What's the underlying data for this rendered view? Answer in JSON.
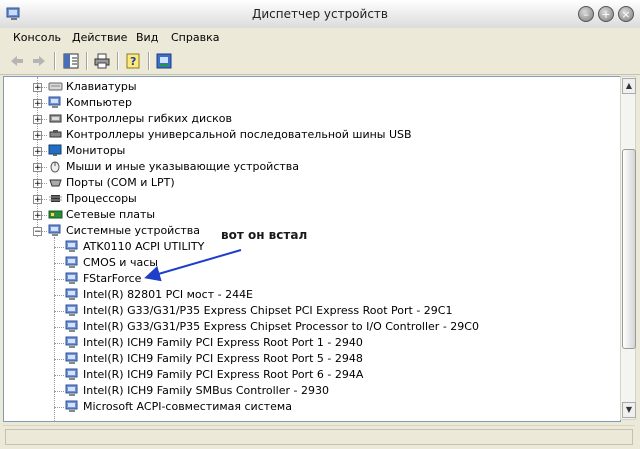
{
  "window": {
    "title": "Диспетчер устройств"
  },
  "menu": [
    "Консоль",
    "Действие",
    "Вид",
    "Справка"
  ],
  "toolbar": {
    "buttons": [
      "back-icon",
      "forward-icon",
      "show-hide-tree-icon",
      "print-icon",
      "help-icon",
      "properties-icon"
    ]
  },
  "tree": {
    "categories": [
      {
        "label": "Клавиатуры",
        "icon": "keyboard-icon",
        "expanded": false
      },
      {
        "label": "Компьютер",
        "icon": "computer-icon",
        "expanded": false
      },
      {
        "label": "Контроллеры гибких дисков",
        "icon": "controller-icon",
        "expanded": false
      },
      {
        "label": "Контроллеры универсальной последовательной шины USB",
        "icon": "usb-icon",
        "expanded": false
      },
      {
        "label": "Мониторы",
        "icon": "monitor-icon",
        "expanded": false
      },
      {
        "label": "Мыши и иные указывающие устройства",
        "icon": "mouse-icon",
        "expanded": false
      },
      {
        "label": "Порты (COM и LPT)",
        "icon": "port-icon",
        "expanded": false
      },
      {
        "label": "Процессоры",
        "icon": "processor-icon",
        "expanded": false
      },
      {
        "label": "Сетевые платы",
        "icon": "network-card-icon",
        "expanded": false
      },
      {
        "label": "Системные устройства",
        "icon": "system-device-icon",
        "expanded": true
      }
    ],
    "system_devices": [
      "ATK0110 ACPI UTILITY",
      "CMOS и часы",
      "FStarForce",
      "Intel(R) 82801 PCI мост - 244E",
      "Intel(R) G33/G31/P35 Express Chipset PCI Express Root Port - 29C1",
      "Intel(R) G33/G31/P35 Express Chipset Processor to I/O Controller - 29C0",
      "Intel(R) ICH9 Family PCI Express Root Port 1 - 2940",
      "Intel(R) ICH9 Family PCI Express Root Port 5 - 2948",
      "Intel(R) ICH9 Family PCI Express Root Port 6 - 294A",
      "Intel(R) ICH9 Family SMBus Controller - 2930",
      "Microsoft ACPI-совместимая система"
    ]
  },
  "annotation": {
    "text": "вот он встал"
  },
  "colors": {
    "arrow": "#1f3fc8",
    "tree_bg": "#ffffff",
    "chrome": "#ece9d8"
  }
}
